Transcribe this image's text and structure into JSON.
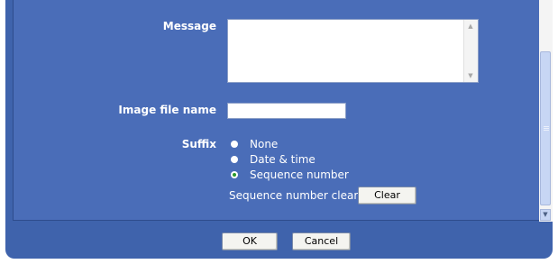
{
  "form": {
    "message_label": "Message",
    "message_value": "",
    "image_file_name_label": "Image file name",
    "image_file_name_value": "",
    "suffix_label": "Suffix",
    "suffix_options": [
      {
        "label": "None",
        "selected": false
      },
      {
        "label": "Date & time",
        "selected": false
      },
      {
        "label": "Sequence number",
        "selected": true
      }
    ],
    "sequence_clear_label": "Sequence number clear",
    "clear_button": "Clear"
  },
  "footer": {
    "ok_button": "OK",
    "cancel_button": "Cancel"
  },
  "colors": {
    "panel_bg": "#4a6db8",
    "frame_bg": "#3f63ac",
    "selected_radio": "#2c9a2c"
  },
  "icons": {
    "textarea_scroll_up": "triangle-up-icon",
    "textarea_scroll_down": "triangle-down-icon",
    "page_scroll_down": "chevron-down-icon"
  }
}
